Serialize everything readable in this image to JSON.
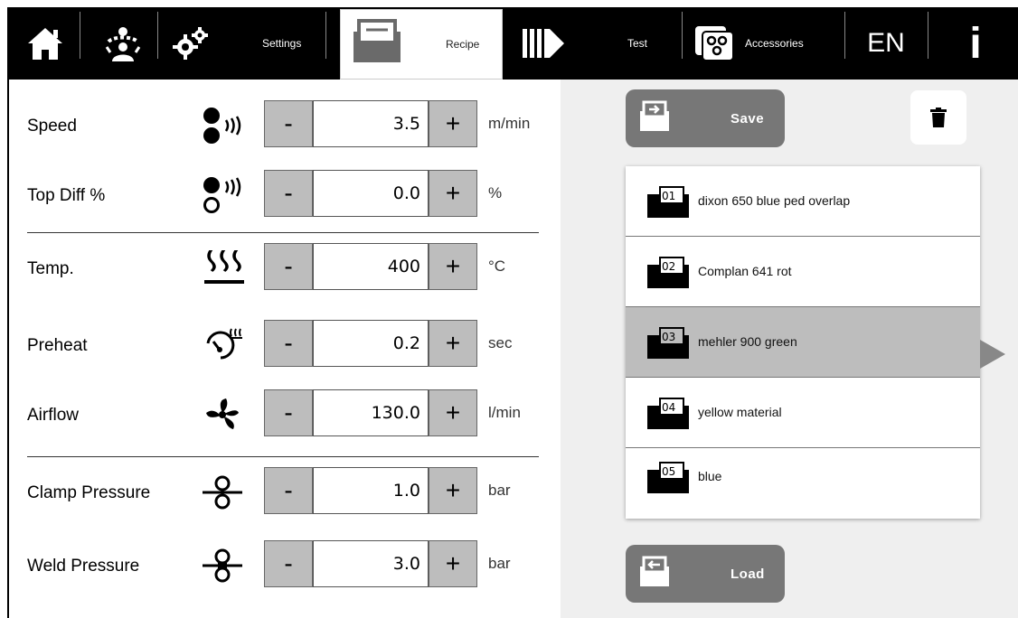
{
  "nav": {
    "settings_label": "Settings",
    "recipe_label": "Recipe",
    "test_label": "Test",
    "accessories_label": "Accessories",
    "language_label": "EN",
    "info_label": "i"
  },
  "params": [
    {
      "label": "Speed",
      "icon": "speed-icon",
      "value": "3.5",
      "unit": "m/min"
    },
    {
      "label": "Top Diff %",
      "icon": "top-diff-icon",
      "value": "0.0",
      "unit": "%"
    },
    {
      "label": "Temp.",
      "icon": "heater-icon",
      "value": "400",
      "unit": "°C"
    },
    {
      "label": "Preheat",
      "icon": "preheat-timer-icon",
      "value": "0.2",
      "unit": "sec"
    },
    {
      "label": "Airflow",
      "icon": "fan-icon",
      "value": "130.0",
      "unit": "l/min"
    },
    {
      "label": "Clamp Pressure",
      "icon": "clamp-pressure-icon",
      "value": "1.0",
      "unit": "bar"
    },
    {
      "label": "Weld Pressure",
      "icon": "weld-pressure-icon",
      "value": "3.0",
      "unit": "bar"
    }
  ],
  "stepper": {
    "minus": "-",
    "plus": "+"
  },
  "actions": {
    "save_label": "Save",
    "load_label": "Load"
  },
  "recipes": [
    {
      "num": "01",
      "name": "dixon 650 blue ped overlap"
    },
    {
      "num": "02",
      "name": "Complan 641 rot"
    },
    {
      "num": "03",
      "name": "mehler 900 green",
      "selected": true
    },
    {
      "num": "04",
      "name": "yellow material"
    },
    {
      "num": "05",
      "name": "blue"
    }
  ],
  "colors": {
    "nav_bg": "#000000",
    "button_gray": "#777777",
    "stepper_gray": "#bdbdbd",
    "selected_row": "#bdbdbd"
  }
}
